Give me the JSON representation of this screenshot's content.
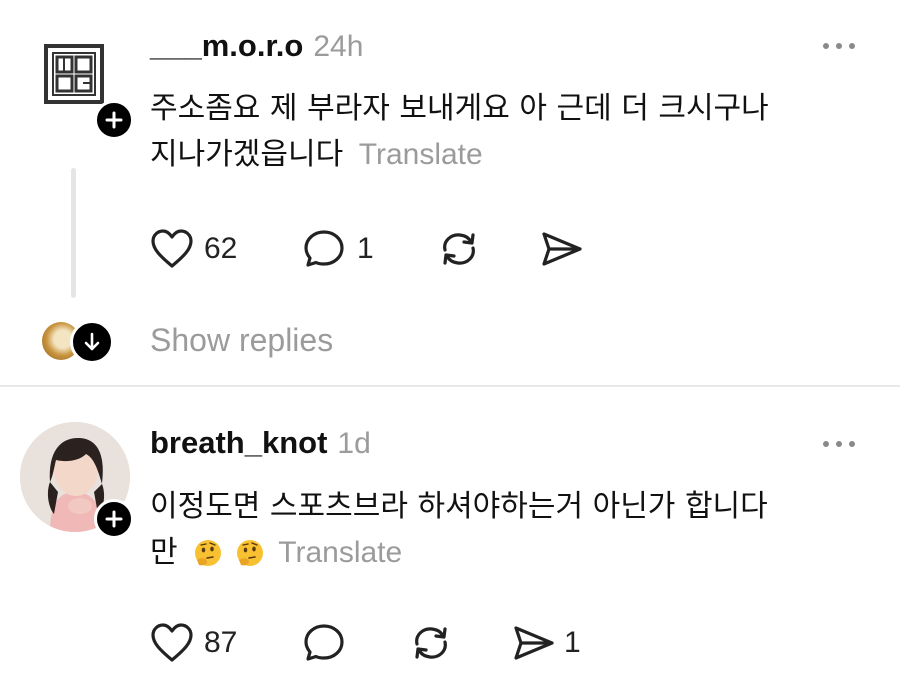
{
  "posts": [
    {
      "username": "___m.o.r.o",
      "time": "24h",
      "text_line1": "주소좀요 제 부라자 보내게요 아 근데 더 크시구나",
      "text_line2": "지나가겠읍니다",
      "translate": "Translate",
      "likes": "62",
      "comments": "1",
      "shares": ""
    },
    {
      "username": "breath_knot",
      "time": "1d",
      "text_line1": "이정도면 스포츠브라 하셔야하는거 아닌가 합니다",
      "text_line2": "만",
      "emojis": [
        "thinking-face",
        "thinking-face"
      ],
      "translate": "Translate",
      "likes": "87",
      "comments": "",
      "shares": "1"
    }
  ],
  "show_replies": "Show replies",
  "colors": {
    "muted": "#9b9b9b",
    "text": "#111111",
    "divider": "#e6e6e6"
  }
}
